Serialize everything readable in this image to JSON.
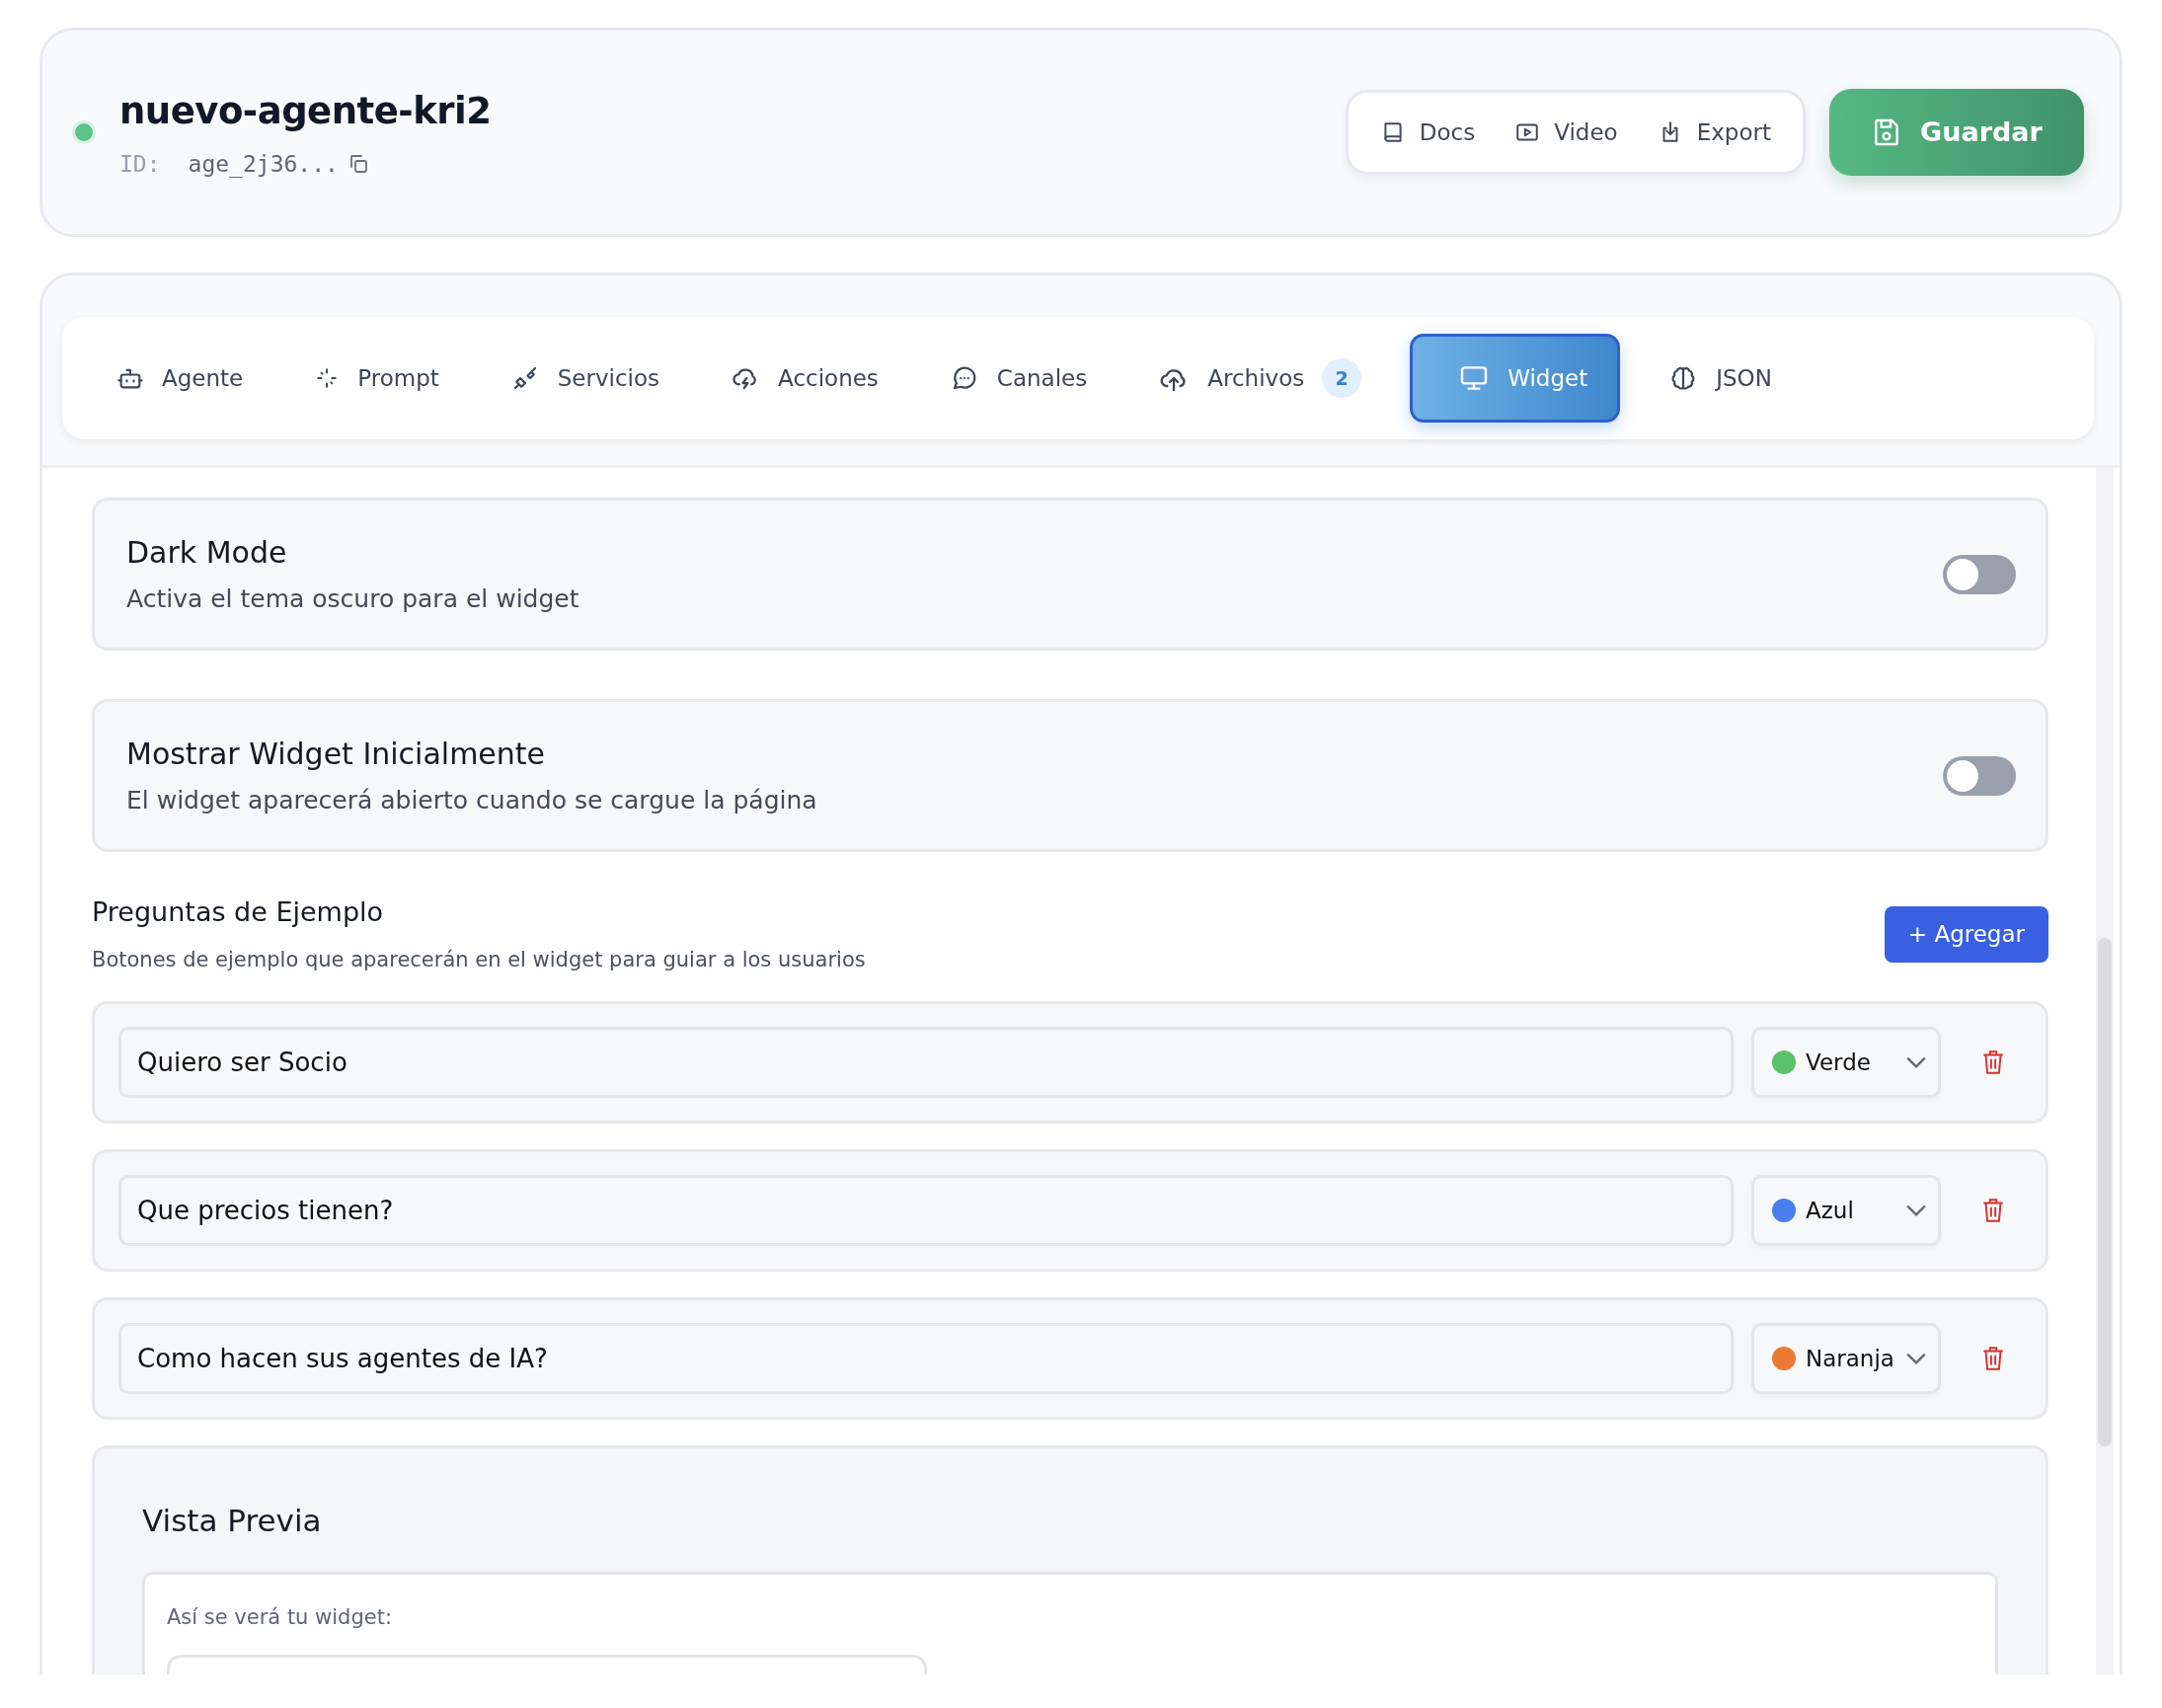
{
  "agent": {
    "name": "nuevo-agente-kri2",
    "online": true,
    "id_label": "ID:",
    "id_value": "age_2j36..."
  },
  "toolbar": [
    {
      "kind": "docs",
      "label": "Docs"
    },
    {
      "kind": "video",
      "label": "Video"
    },
    {
      "kind": "export",
      "label": "Export"
    }
  ],
  "save_button": "Guardar",
  "tabs": [
    {
      "kind": "agent",
      "label": "Agente",
      "selected": false
    },
    {
      "kind": "prompt",
      "label": "Prompt",
      "selected": false
    },
    {
      "kind": "services",
      "label": "Servicios",
      "selected": false
    },
    {
      "kind": "actions",
      "label": "Acciones",
      "selected": false
    },
    {
      "kind": "channels",
      "label": "Canales",
      "selected": false
    },
    {
      "kind": "files",
      "label": "Archivos",
      "badge": "2",
      "selected": false
    },
    {
      "kind": "widget",
      "label": "Widget",
      "selected": true
    },
    {
      "kind": "json",
      "label": "JSON",
      "selected": false
    }
  ],
  "settings": [
    {
      "title": "Dark Mode",
      "description": "Activa el tema oscuro para el widget",
      "on": false
    },
    {
      "title": "Mostrar Widget Inicialmente",
      "description": "El widget aparecerá abierto cuando se cargue la página",
      "on": false
    }
  ],
  "examples": {
    "title": "Preguntas de Ejemplo",
    "description": "Botones de ejemplo que aparecerán en el widget para guiar a los usuarios",
    "add_button": "+ Agregar",
    "items": [
      {
        "text": "Quiero ser Socio",
        "color_label": "Verde",
        "color": "#5cc16b"
      },
      {
        "text": "Que precios tienen?",
        "color_label": "Azul",
        "color": "#4a7fef"
      },
      {
        "text": "Como hacen sus agentes de IA?",
        "color_label": "Naranja",
        "color": "#e97a33"
      }
    ]
  },
  "preview": {
    "title": "Vista Previa",
    "caption": "Así se verá tu widget:"
  }
}
